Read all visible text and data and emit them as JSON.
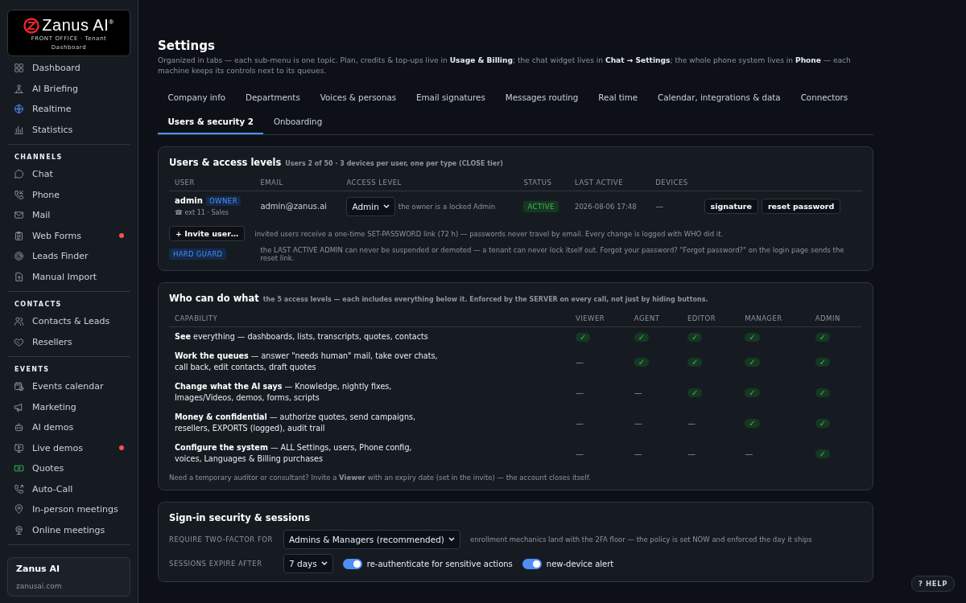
{
  "brand": {
    "name": "Zanus AI$^{®}$",
    "subtitle": "FRONT OFFICE · Tenant Dashboard"
  },
  "sidebar": {
    "groups": [
      {
        "items": [
          {
            "label": "Dashboard",
            "alert": false
          },
          {
            "label": "AI Briefing",
            "alert": false
          },
          {
            "label": "Realtime",
            "alert": false
          },
          {
            "label": "Statistics",
            "alert": false
          }
        ]
      },
      {
        "heading": "CHANNELS",
        "items": [
          {
            "label": "Chat",
            "alert": false
          },
          {
            "label": "Phone",
            "alert": false
          },
          {
            "label": "Mail",
            "alert": false
          },
          {
            "label": "Web Forms",
            "alert": true
          },
          {
            "label": "Leads Finder",
            "alert": false
          },
          {
            "label": "Manual Import",
            "alert": false
          }
        ]
      },
      {
        "heading": "CONTACTS",
        "items": [
          {
            "label": "Contacts & Leads",
            "alert": false
          },
          {
            "label": "Resellers",
            "alert": false
          }
        ]
      },
      {
        "heading": "EVENTS",
        "items": [
          {
            "label": "Events calendar",
            "alert": false
          },
          {
            "label": "Marketing",
            "alert": false
          },
          {
            "label": "AI demos",
            "alert": false
          },
          {
            "label": "Live demos",
            "alert": true
          },
          {
            "label": "Quotes",
            "alert": false
          },
          {
            "label": "Auto-Call",
            "alert": false
          },
          {
            "label": "In-person meetings",
            "alert": false
          },
          {
            "label": "Online meetings",
            "alert": false
          }
        ]
      }
    ],
    "footer": {
      "name": "Zanus AI",
      "url": "zanusai.com"
    }
  },
  "page": {
    "title": "Settings",
    "intro": "Organized in tabs — each sub-menu is one topic. Plan, credits & top-ups live in **Usage & Billing**; the chat widget lives in **Chat → Settings**; the whole phone system lives in **Phone** — each machine keeps its controls next to its queues."
  },
  "tab_rows": [
    {
      "tabs": [
        {
          "label": "Company info",
          "selected": false
        },
        {
          "label": "Departments",
          "selected": false
        },
        {
          "label": "Voices & personas",
          "selected": false
        },
        {
          "label": "Email signatures",
          "selected": false
        },
        {
          "label": "Messages routing",
          "selected": false
        },
        {
          "label": "Real time",
          "selected": false
        },
        {
          "label": "Calendar, integrations & data",
          "selected": false
        },
        {
          "label": "Connectors",
          "selected": false
        }
      ]
    },
    {
      "tabs": [
        {
          "label": "Users & security 2",
          "selected": true
        },
        {
          "label": "Onboarding",
          "selected": false
        }
      ]
    }
  ],
  "users": {
    "title": "Users & access levels",
    "subtitle": "Users 2 of 50 · 3 devices per user, one per type (CLOSE tier)",
    "columns": [
      "USER",
      "EMAIL",
      "ACCESS LEVEL",
      "STATUS",
      "LAST ACTIVE",
      "DEVICES"
    ],
    "rows": [
      {
        "name": "admin",
        "badge": "OWNER",
        "ext": "☎ ext 11 · Sales",
        "email": "admin@zanus.ai",
        "access_level": "Admin",
        "access_note": "the owner is a locked Admin",
        "status": "ACTIVE",
        "last_active": "2026-08-06 17:48",
        "devices": "—",
        "actions": [
          "signature",
          "reset password"
        ]
      }
    ],
    "invite": {
      "button": "+ Invite user…",
      "note": "invited users receive a one-time SET-PASSWORD link (72 h) — passwords never travel by email. Every change is logged with WHO did it."
    },
    "guard": {
      "badge": "HARD GUARD",
      "note": "the LAST ACTIVE ADMIN can never be suspended or demoted — a tenant can never lock itself out. Forgot your password? \"Forgot password?\" on the login page sends the reset link."
    }
  },
  "permissions": {
    "title": "Who can do what",
    "subtitle": "the 5 access levels — each includes everything below it. Enforced by the SERVER on every call, not just by hiding buttons.",
    "columns": [
      "CAPABILITY",
      "VIEWER",
      "AGENT",
      "EDITOR",
      "MANAGER",
      "ADMIN"
    ],
    "rows": [
      {
        "capability": "**See** everything — dashboards, lists, transcripts, quotes, contacts",
        "levels": [
          {
            "allowed": true,
            "text": "✓"
          },
          {
            "allowed": true,
            "text": "✓"
          },
          {
            "allowed": true,
            "text": "✓"
          },
          {
            "allowed": true,
            "text": "✓"
          },
          {
            "allowed": true,
            "text": "✓"
          }
        ]
      },
      {
        "capability": "**Work the queues** — answer \"needs human\" mail, take over chats, call back, edit contacts, draft quotes",
        "levels": [
          {
            "allowed": false,
            "text": "—"
          },
          {
            "allowed": true,
            "text": "✓"
          },
          {
            "allowed": true,
            "text": "✓"
          },
          {
            "allowed": true,
            "text": "✓"
          },
          {
            "allowed": true,
            "text": "✓"
          }
        ]
      },
      {
        "capability": "**Change what the AI says** — Knowledge, nightly fixes, Images/Videos, demos, forms, scripts",
        "levels": [
          {
            "allowed": false,
            "text": "—"
          },
          {
            "allowed": false,
            "text": "—"
          },
          {
            "allowed": true,
            "text": "✓"
          },
          {
            "allowed": true,
            "text": "✓"
          },
          {
            "allowed": true,
            "text": "✓"
          }
        ]
      },
      {
        "capability": "**Money & confidential** — authorize quotes, send campaigns, resellers, EXPORTS (logged), audit trail",
        "levels": [
          {
            "allowed": false,
            "text": "—"
          },
          {
            "allowed": false,
            "text": "—"
          },
          {
            "allowed": false,
            "text": "—"
          },
          {
            "allowed": true,
            "text": "✓"
          },
          {
            "allowed": true,
            "text": "✓"
          }
        ]
      },
      {
        "capability": "**Configure the system** — ALL Settings, users, Phone config, voices, Languages & Billing purchases",
        "levels": [
          {
            "allowed": false,
            "text": "—"
          },
          {
            "allowed": false,
            "text": "—"
          },
          {
            "allowed": false,
            "text": "—"
          },
          {
            "allowed": false,
            "text": "—"
          },
          {
            "allowed": true,
            "text": "✓"
          }
        ]
      }
    ],
    "footnote": "Need a temporary auditor or consultant? Invite a **Viewer** with an expiry date (set in the invite) — the account closes itself."
  },
  "security": {
    "title": "Sign-in security & sessions",
    "two_factor": {
      "label": "REQUIRE TWO-FACTOR FOR",
      "value": "Admins & Managers (recommended)",
      "note": "enrollment mechanics land with the 2FA floor — the policy is set NOW and enforced the day it ships"
    },
    "sessions": {
      "label": "SESSIONS EXPIRE AFTER",
      "value": "7 days",
      "toggles": [
        {
          "label": "re-authenticate for sensitive actions",
          "on": true
        },
        {
          "label": "new-device alert",
          "on": true
        }
      ]
    }
  },
  "help": "? HELP"
}
